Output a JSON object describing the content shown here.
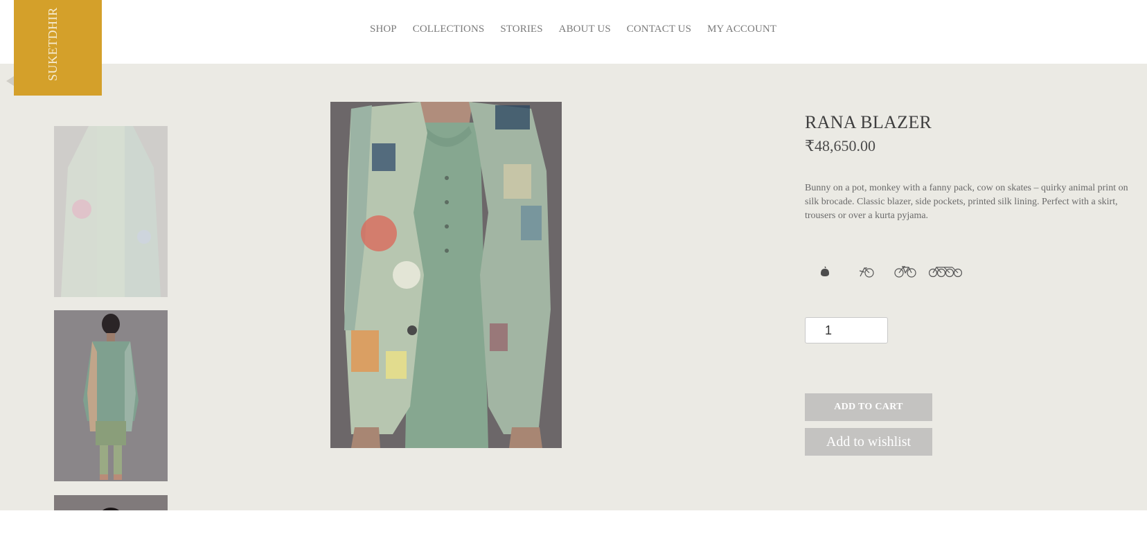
{
  "brand": {
    "name": "SUKETDHIR",
    "color": "#d4a02a"
  },
  "nav": [
    {
      "label": "SHOP"
    },
    {
      "label": "COLLECTIONS"
    },
    {
      "label": "STORIES"
    },
    {
      "label": "ABOUT US"
    },
    {
      "label": "CONTACT US"
    },
    {
      "label": "MY ACCOUNT"
    }
  ],
  "product": {
    "title": "RANA BLAZER",
    "price": "₹48,650.00",
    "description": "Bunny on a pot, monkey with a fanny pack, cow on skates – quirky animal print on silk brocade. Classic blazer, side pockets, printed silk lining. Perfect with a skirt, trousers or over a kurta pyjama.",
    "quantity": "1",
    "add_to_cart_label": "ADD TO CART",
    "wishlist_label": "Add to wishlist",
    "rating_icons": [
      "sesame-icon",
      "one-bike-icon",
      "two-bikes-icon",
      "three-bikes-icon"
    ]
  },
  "gallery": {
    "thumbnails": [
      "front-view",
      "back-view",
      "detail-view"
    ],
    "main": "front-view"
  },
  "colors": {
    "background": "#ebeae4",
    "button": "#c4c3c1",
    "text": "#5a5a5a"
  }
}
